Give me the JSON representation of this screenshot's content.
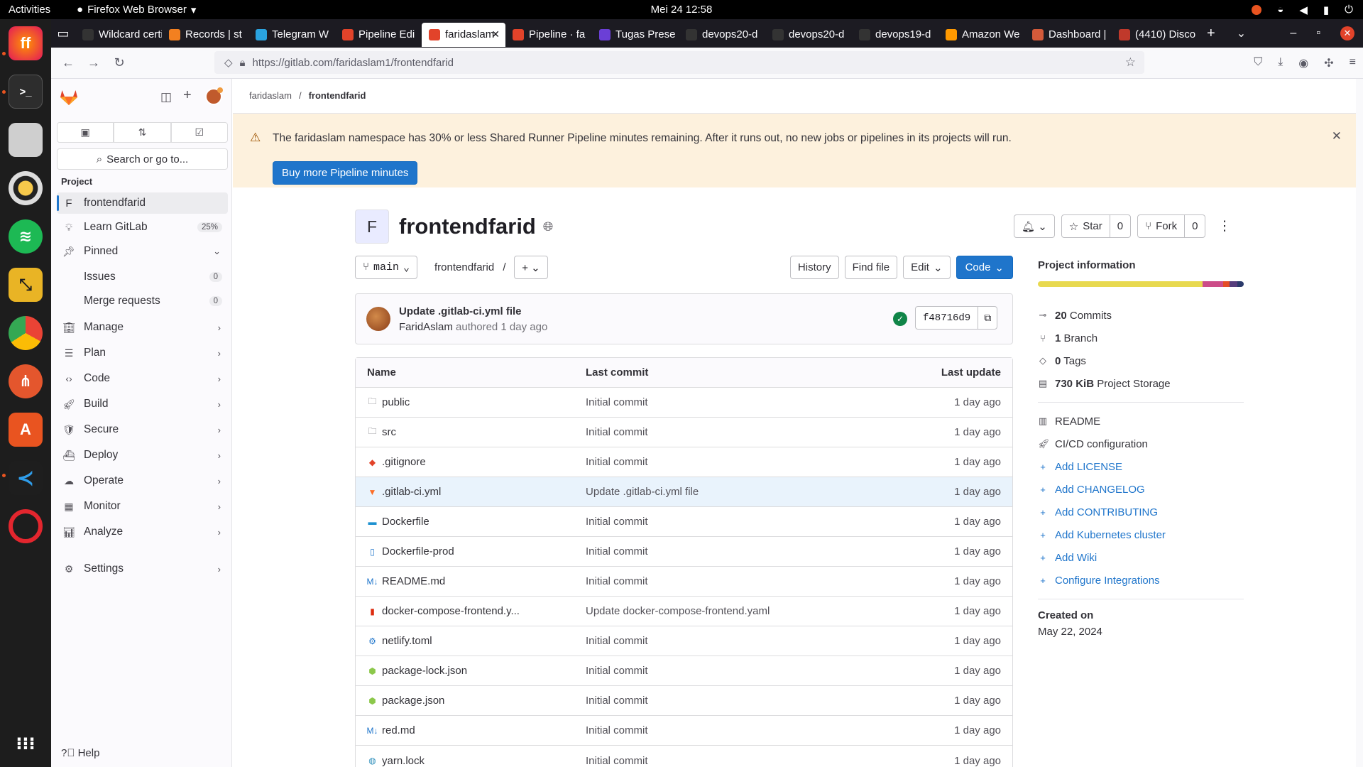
{
  "os": {
    "activities": "Activities",
    "app_name": "Firefox Web Browser",
    "clock": "Mei 24  12:58"
  },
  "browser": {
    "tabs": [
      {
        "label": "Wildcard certif",
        "color": "#333"
      },
      {
        "label": "Records | st",
        "color": "#f38020"
      },
      {
        "label": "Telegram W",
        "color": "#2aa3df"
      },
      {
        "label": "Pipeline Edi",
        "color": "#e2432a"
      },
      {
        "label": "faridaslam",
        "color": "#e2432a",
        "active": true
      },
      {
        "label": "Pipeline · fa",
        "color": "#e2432a"
      },
      {
        "label": "Tugas Prese",
        "color": "#6b3fd6"
      },
      {
        "label": "devops20-d",
        "color": "#333"
      },
      {
        "label": "devops20-d",
        "color": "#333"
      },
      {
        "label": "devops19-d",
        "color": "#333"
      },
      {
        "label": "Amazon We",
        "color": "#ff9900"
      },
      {
        "label": "Dashboard |",
        "color": "#d35a3a"
      },
      {
        "label": "(4410) Disco",
        "color": "#c0392b"
      }
    ],
    "url": "https://gitlab.com/faridaslam1/frontendfarid"
  },
  "sidebar": {
    "search_placeholder": "Search or go to...",
    "section": "Project",
    "project_letter": "F",
    "project_name": "frontendfarid",
    "learn": "Learn GitLab",
    "learn_pct": "25%",
    "pinned": "Pinned",
    "issues": "Issues",
    "issues_count": "0",
    "mrs": "Merge requests",
    "mrs_count": "0",
    "groups": [
      "Manage",
      "Plan",
      "Code",
      "Build",
      "Secure",
      "Deploy",
      "Operate",
      "Monitor",
      "Analyze"
    ],
    "settings": "Settings",
    "help": "Help"
  },
  "breadcrumb": {
    "owner": "faridaslam",
    "project": "frontendfarid"
  },
  "alert": {
    "message": "The faridaslam namespace has 30% or less Shared Runner Pipeline minutes remaining. After it runs out, no new jobs or pipelines in its projects will run.",
    "button": "Buy more Pipeline minutes"
  },
  "project": {
    "letter": "F",
    "name": "frontendfarid",
    "star_label": "Star",
    "star_count": "0",
    "fork_label": "Fork",
    "fork_count": "0"
  },
  "toolbar": {
    "branch": "main",
    "path": "frontendfarid",
    "path_sep": "/",
    "history": "History",
    "find_file": "Find file",
    "edit": "Edit",
    "code": "Code"
  },
  "commit": {
    "title": "Update .gitlab-ci.yml file",
    "author": "FaridAslam",
    "meta": "authored 1 day ago",
    "sha": "f48716d9"
  },
  "files": {
    "headers": [
      "Name",
      "Last commit",
      "Last update"
    ],
    "rows": [
      {
        "name": "public",
        "icon": "folder-icon",
        "commit": "Initial commit",
        "updated": "1 day ago"
      },
      {
        "name": "src",
        "icon": "folder-icon",
        "commit": "Initial commit",
        "updated": "1 day ago"
      },
      {
        "name": ".gitignore",
        "icon": "git-icon",
        "commit": "Initial commit",
        "updated": "1 day ago"
      },
      {
        "name": ".gitlab-ci.yml",
        "icon": "gitlab-icon",
        "commit": "Update .gitlab-ci.yml file",
        "updated": "1 day ago",
        "highlight": true
      },
      {
        "name": "Dockerfile",
        "icon": "docker-icon",
        "commit": "Initial commit",
        "updated": "1 day ago"
      },
      {
        "name": "Dockerfile-prod",
        "icon": "file-icon",
        "commit": "Initial commit",
        "updated": "1 day ago"
      },
      {
        "name": "README.md",
        "icon": "markdown-icon",
        "commit": "Initial commit",
        "updated": "1 day ago"
      },
      {
        "name": "docker-compose-frontend.y...",
        "icon": "yaml-icon",
        "commit": "Update docker-compose-frontend.yaml",
        "updated": "1 day ago"
      },
      {
        "name": "netlify.toml",
        "icon": "gear-icon",
        "commit": "Initial commit",
        "updated": "1 day ago"
      },
      {
        "name": "package-lock.json",
        "icon": "node-icon",
        "commit": "Initial commit",
        "updated": "1 day ago"
      },
      {
        "name": "package.json",
        "icon": "node-icon",
        "commit": "Initial commit",
        "updated": "1 day ago"
      },
      {
        "name": "red.md",
        "icon": "markdown-icon",
        "commit": "Initial commit",
        "updated": "1 day ago"
      },
      {
        "name": "yarn.lock",
        "icon": "yarn-icon",
        "commit": "Initial commit",
        "updated": "1 day ago"
      }
    ]
  },
  "info": {
    "title": "Project information",
    "languages": [
      {
        "share": 0.8,
        "color": "#e8d94f"
      },
      {
        "share": 0.1,
        "color": "#cc4c88"
      },
      {
        "share": 0.03,
        "color": "#e44d26"
      },
      {
        "share": 0.04,
        "color": "#563d7c"
      },
      {
        "share": 0.03,
        "color": "#2b3a6b"
      }
    ],
    "commits_n": "20",
    "commits_l": "Commits",
    "branch_n": "1",
    "branch_l": "Branch",
    "tags_n": "0",
    "tags_l": "Tags",
    "storage_n": "730 KiB",
    "storage_l": "Project Storage",
    "readme": "README",
    "cicd": "CI/CD configuration",
    "links": [
      "Add LICENSE",
      "Add CHANGELOG",
      "Add CONTRIBUTING",
      "Add Kubernetes cluster",
      "Add Wiki",
      "Configure Integrations"
    ],
    "created_label": "Created on",
    "created_value": "May 22, 2024"
  }
}
